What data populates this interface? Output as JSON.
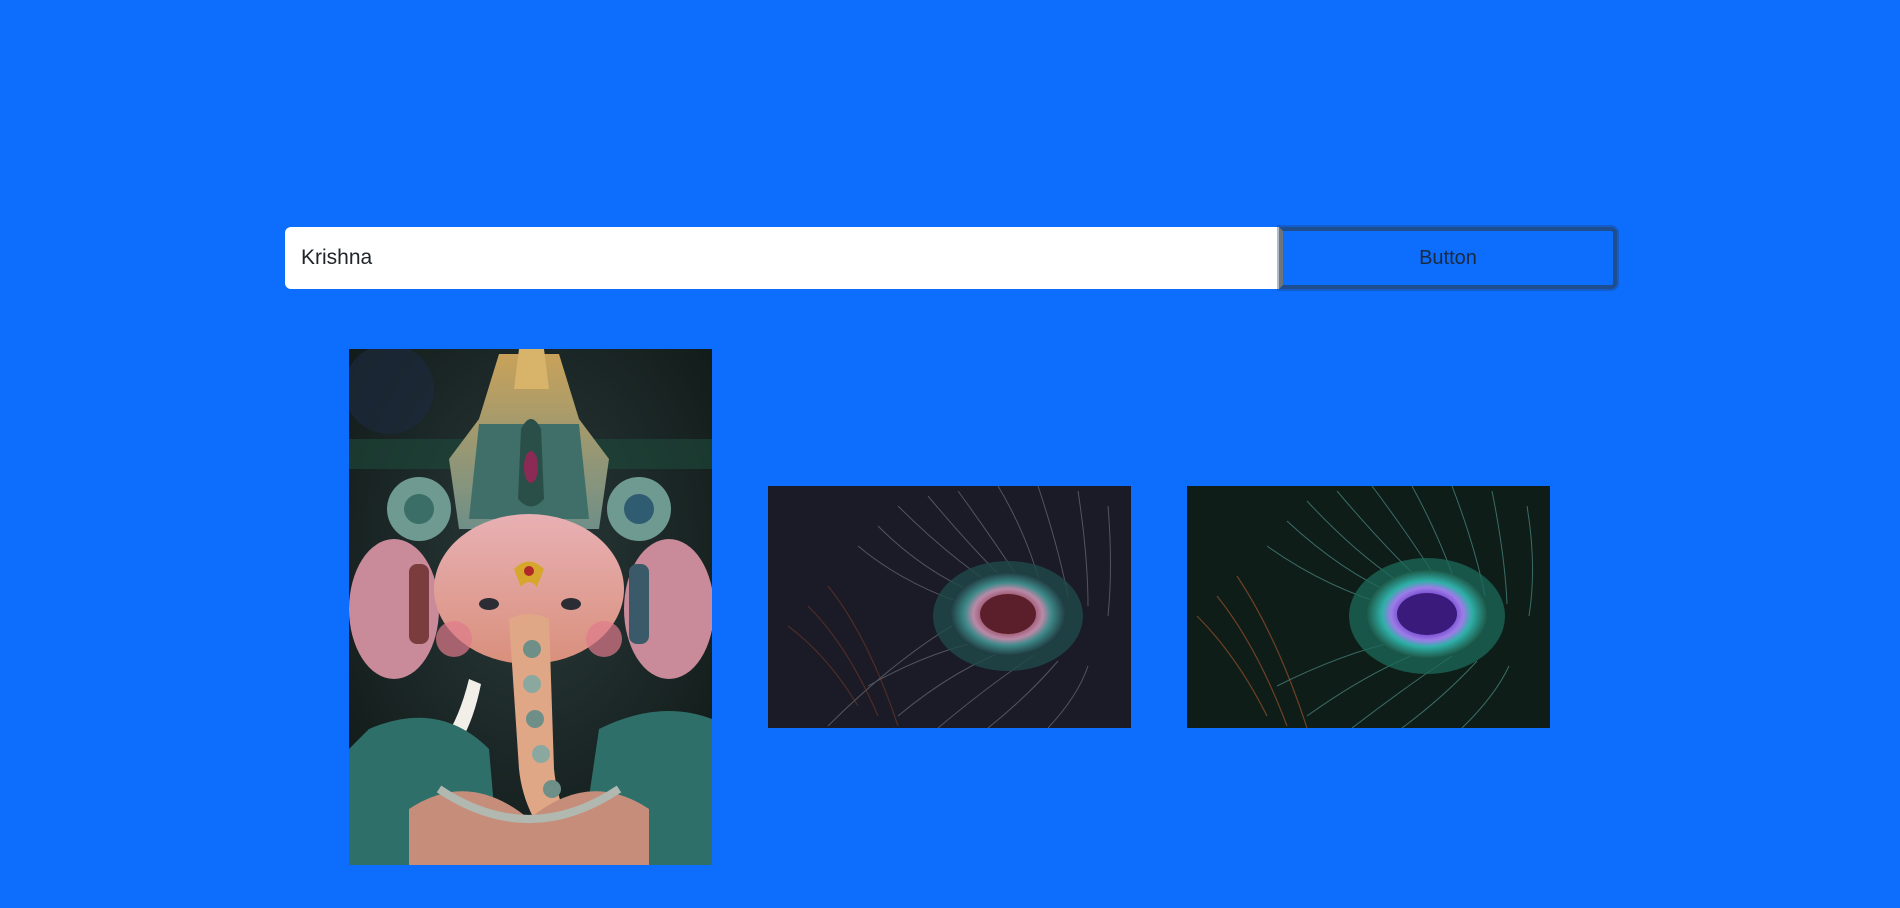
{
  "search": {
    "value": "Krishna",
    "button_label": "Button"
  },
  "results": [
    {
      "icon": "ganesha-idol-image"
    },
    {
      "icon": "peacock-feather-image"
    },
    {
      "icon": "peacock-feather-image"
    }
  ],
  "colors": {
    "background": "#0d6efd",
    "input_background": "#ffffff",
    "button_border": "#1f4e8f"
  }
}
